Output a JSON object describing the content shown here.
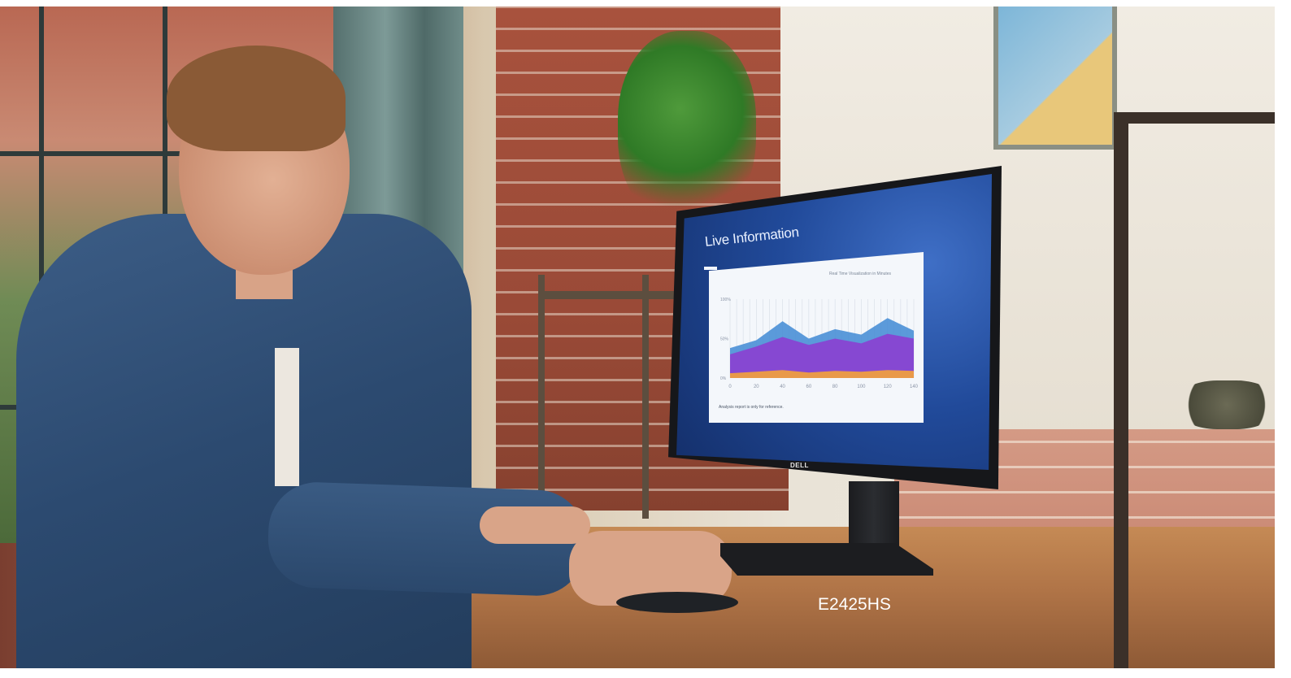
{
  "monitor": {
    "screen_title": "Live Information",
    "card_caption": "Real Time Visualization in Minutes",
    "card_footer": "Analysis report is only for reference.",
    "brand_logo": "DELL"
  },
  "product": {
    "model_label": "E2425HS"
  },
  "chart_data": {
    "type": "area",
    "x": [
      0,
      20,
      40,
      60,
      80,
      100,
      120,
      140
    ],
    "xticks": [
      "0",
      "20",
      "40",
      "60",
      "80",
      "100",
      "120",
      "140"
    ],
    "yticks": [
      "0%",
      "50%",
      "100%"
    ],
    "series": [
      {
        "values": [
          0.38,
          0.48,
          0.72,
          0.5,
          0.62,
          0.55,
          0.76,
          0.6
        ]
      },
      {
        "values": [
          0.3,
          0.4,
          0.52,
          0.42,
          0.5,
          0.44,
          0.56,
          0.5
        ]
      },
      {
        "values": [
          0.06,
          0.08,
          0.1,
          0.07,
          0.09,
          0.08,
          0.1,
          0.09
        ]
      }
    ],
    "colors": [
      "#4a8fd6",
      "#8b3fd0",
      "#f4a23a"
    ]
  }
}
